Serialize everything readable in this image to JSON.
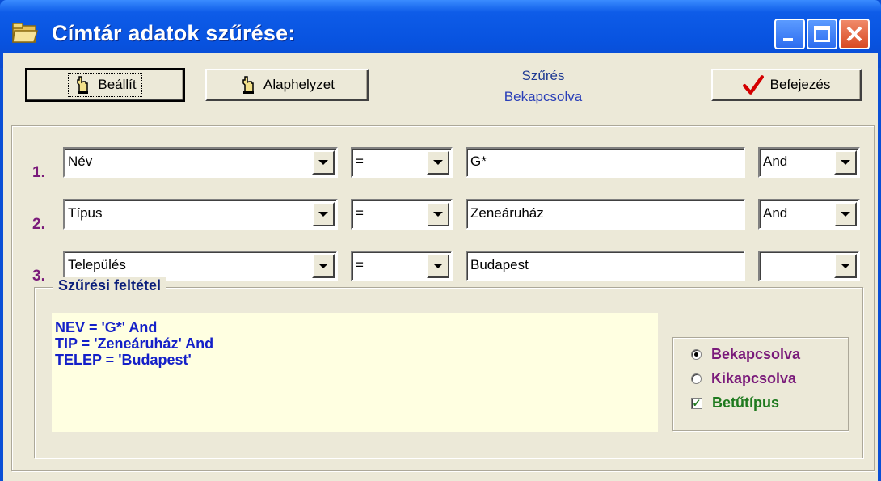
{
  "window": {
    "title": "Címtár adatok szűrése:"
  },
  "toolbar": {
    "set_label": "Beállít",
    "reset_label": "Alaphelyzet",
    "finish_label": "Befejezés"
  },
  "status": {
    "line1": "Szűrés",
    "line2": "Bekapcsolva"
  },
  "conditions": [
    {
      "num": "1.",
      "field": "Név",
      "operator": "=",
      "value": "G*",
      "logic": "And"
    },
    {
      "num": "2.",
      "field": "Típus",
      "operator": "=",
      "value": "Zeneáruház",
      "logic": "And"
    },
    {
      "num": "3.",
      "field": "Település",
      "operator": "=",
      "value": "Budapest",
      "logic": ""
    }
  ],
  "filter_group": {
    "label": "Szűrési feltétel",
    "lines": [
      "NEV = 'G*' And",
      "TIP = 'Zeneáruház' And",
      "TELEP = 'Budapest'"
    ]
  },
  "options": {
    "on_label": "Bekapcsolva",
    "off_label": "Kikapcsolva",
    "font_label": "Betűtípus",
    "selected": "on",
    "font_checked": true,
    "colors": {
      "on": "#7a1a7a",
      "off": "#7a1a7a",
      "font": "#1f7a1f"
    }
  },
  "icons": {
    "app": "folder-icon",
    "set": "hand-icon",
    "reset": "hand-icon",
    "finish": "checkmark-icon"
  }
}
